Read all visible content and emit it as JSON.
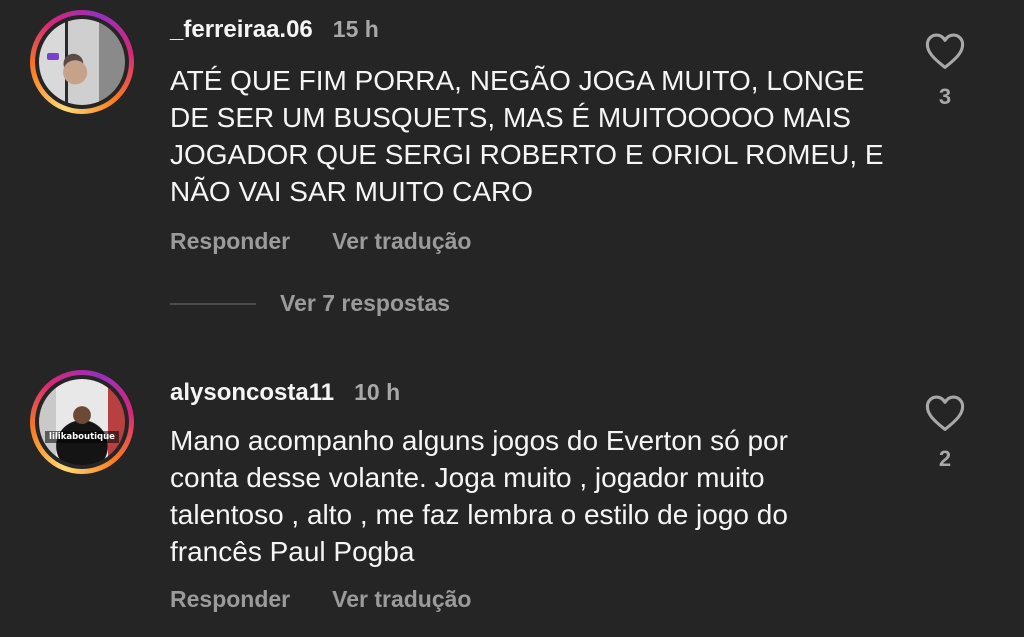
{
  "comments": [
    {
      "username": "_ferreiraa.06",
      "time": "15 h",
      "text": "ATÉ QUE FIM PORRA, NEGÃO JOGA MUITO, LONGE\nDE SER UM BUSQUETS, MAS É MUITOOOOO MAIS\nJOGADOR QUE SERGI ROBERTO E ORIOL ROMEU, E\nNÃO VAI SAR MUITO CARO",
      "likes": "3",
      "reply_label": "Responder",
      "translate_label": "Ver tradução",
      "view_replies_label": "Ver 7 respostas"
    },
    {
      "username": "alysoncosta11",
      "time": "10 h",
      "text": "Mano acompanho alguns jogos do Everton só por\nconta desse volante. Joga muito , jogador muito\ntalentoso , alto , me faz lembra o estilo de jogo do\nfrancês Paul Pogba",
      "likes": "2",
      "reply_label": "Responder",
      "translate_label": "Ver tradução",
      "avatar_overlay_text": "lilikaboutique"
    }
  ],
  "icons": {
    "like": "heart-outline-icon"
  },
  "colors": {
    "background": "#252525",
    "text_primary": "#f5f5f5",
    "text_secondary": "#a8a8a8"
  }
}
